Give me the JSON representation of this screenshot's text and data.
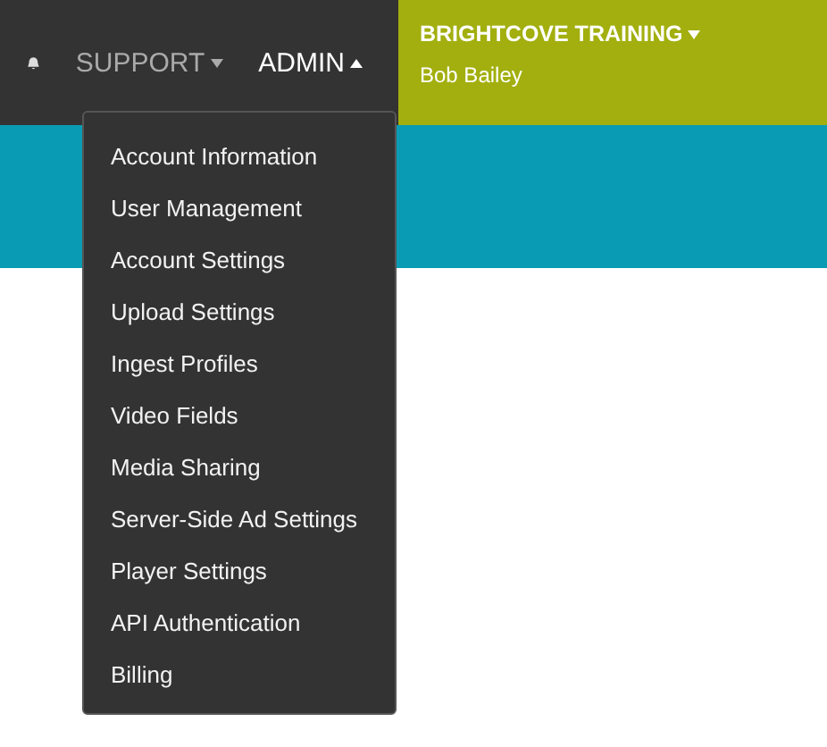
{
  "nav": [
    {
      "kind": "icon"
    },
    {
      "kind": "menu",
      "label": "SUPPORT",
      "expanded": false
    },
    {
      "kind": "menu",
      "label": "ADMIN",
      "expanded": true
    }
  ],
  "account": {
    "name": "BRIGHTCOVE TRAINING",
    "user": "Bob Bailey"
  },
  "admin_menu": [
    "Account Information",
    "User Management",
    "Account Settings",
    "Upload Settings",
    "Ingest Profiles",
    "Video Fields",
    "Media Sharing",
    "Server-Side Ad Settings",
    "Player Settings",
    "API Authentication",
    "Billing"
  ]
}
